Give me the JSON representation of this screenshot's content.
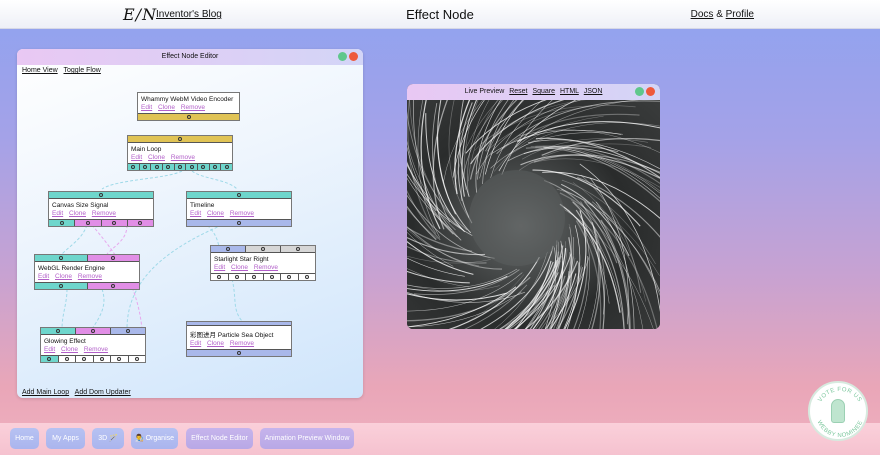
{
  "topbar": {
    "logo": "E/N",
    "blog_link": "Inventor's Blog",
    "title": "Effect Node",
    "docs_link": "Docs",
    "amp": "&",
    "profile_link": "Profile"
  },
  "editor": {
    "title": "Effect Node Editor",
    "links": [
      "Home View",
      "Toggle Flow"
    ],
    "bottom_links": [
      "Add Main Loop",
      "Add Dom Updater"
    ],
    "actions": {
      "edit": "Edit",
      "clone": "Clone",
      "remove": "Remove"
    },
    "nodes": {
      "whammy": "Whammy WebM Video Encoder",
      "main_loop": "Main Loop",
      "canvas_size": "Canvas Size Signal",
      "timeline": "Timeline",
      "webgl": "WebGL Render Engine",
      "starlight": "Starlight Star Right",
      "glowing": "Glowing Effect",
      "particle": "彩图进月 Particle Sea Object"
    }
  },
  "preview": {
    "title": "Live Preview",
    "links": [
      "Reset",
      "Square",
      "HTML",
      "JSON"
    ]
  },
  "dock": {
    "items": [
      "Home",
      "My Apps",
      "3D 🪄",
      "👨‍🎨 Organise",
      "Effect Node Editor",
      "Animation Preview Window"
    ]
  },
  "badge": {
    "text_top": "VOTE FOR US",
    "text_bottom": "WEBBY NOMINEE"
  },
  "colors": {
    "accent_link": "#b25fc9",
    "port_yellow": "#e0c355",
    "port_teal": "#6ed6cc",
    "port_pink": "#e18ee6",
    "port_blue": "#a9b8ea"
  }
}
